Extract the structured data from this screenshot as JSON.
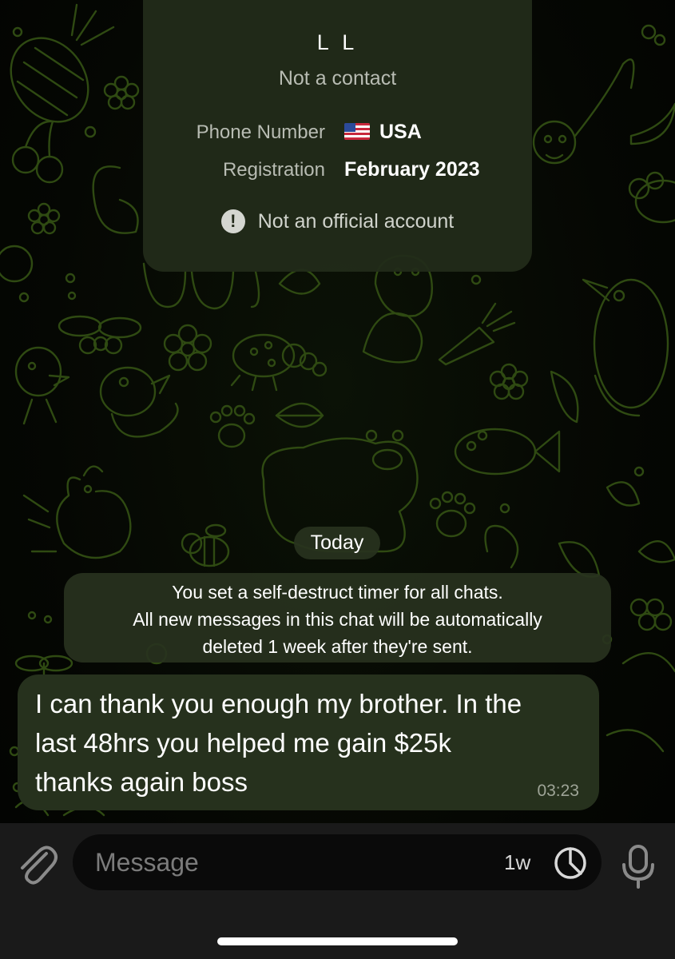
{
  "card": {
    "name": "L L",
    "subtitle": "Not a contact",
    "phone_label": "Phone Number",
    "phone_value": "USA",
    "reg_label": "Registration",
    "reg_value": "February 2023",
    "warning": "Not an official account",
    "flag_icon": "us-flag-icon"
  },
  "date_separator": "Today",
  "service_message": "You set a self-destruct timer for all chats.\nAll new messages in this chat will be automatically\ndeleted 1 week after they're sent.",
  "message": {
    "text": "I can thank you enough my brother. In the\nlast 48hrs you helped me gain $25k\nthanks again boss",
    "time": "03:23"
  },
  "input": {
    "placeholder": "Message",
    "timer": "1w"
  },
  "colors": {
    "wallpaper_stroke": "#2f4a12",
    "bubble_bg": "#26311d",
    "card_bg": "#222c1a"
  }
}
